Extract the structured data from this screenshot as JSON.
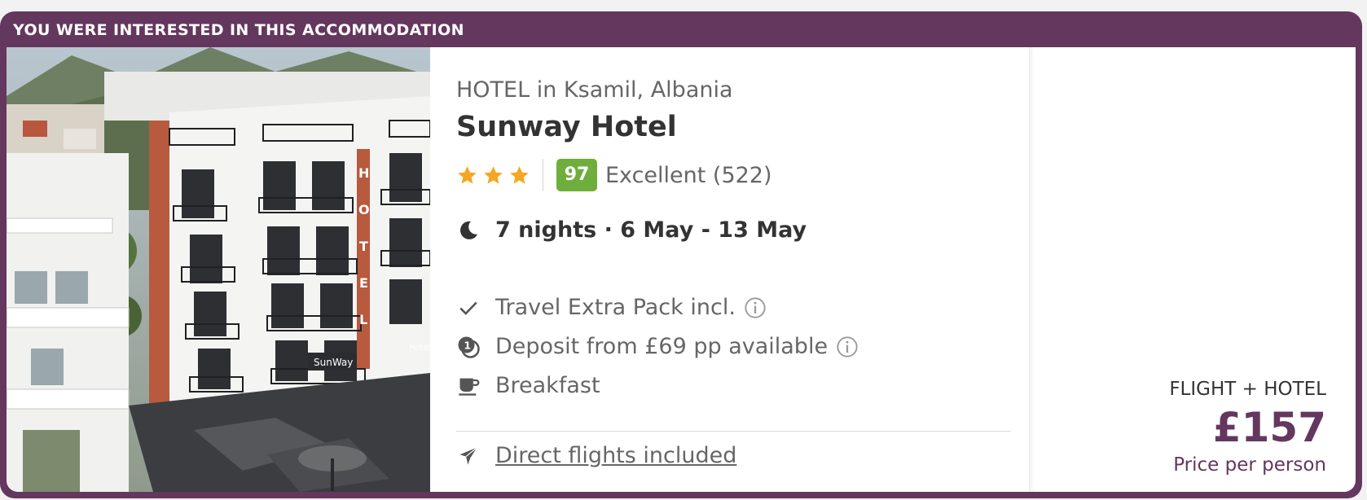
{
  "banner": {
    "text": "YOU WERE INTERESTED IN THIS ACCOMMODATION"
  },
  "hotel": {
    "location": "HOTEL in Ksamil, Albania",
    "name": "Sunway Hotel",
    "stars": 3,
    "score": "97",
    "score_label": "Excellent (522)",
    "image_sign_facade": "HOTEL",
    "image_sign_entrance": "SunWay",
    "image_sign_side": "Hotel"
  },
  "stay": {
    "nights": "7 nights · 6 May - 13 May"
  },
  "features": {
    "extra": "Travel Extra Pack incl.",
    "deposit": "Deposit from £69 pp available",
    "board": "Breakfast",
    "flights": "Direct flights included"
  },
  "price": {
    "package": "FLIGHT + HOTEL",
    "amount": "£157",
    "per_person": "Price per person"
  },
  "colors": {
    "brand": "#64375e",
    "score_green": "#6fae3c",
    "star": "#f5a623",
    "text_dark": "#333333",
    "text_muted": "#666666"
  },
  "icons": {
    "nights": "moon-icon",
    "extra": "check-icon",
    "deposit": "deposit-coin-icon",
    "board": "coffee-cup-icon",
    "flights": "plane-icon",
    "info": "info-icon",
    "star": "star-icon"
  }
}
